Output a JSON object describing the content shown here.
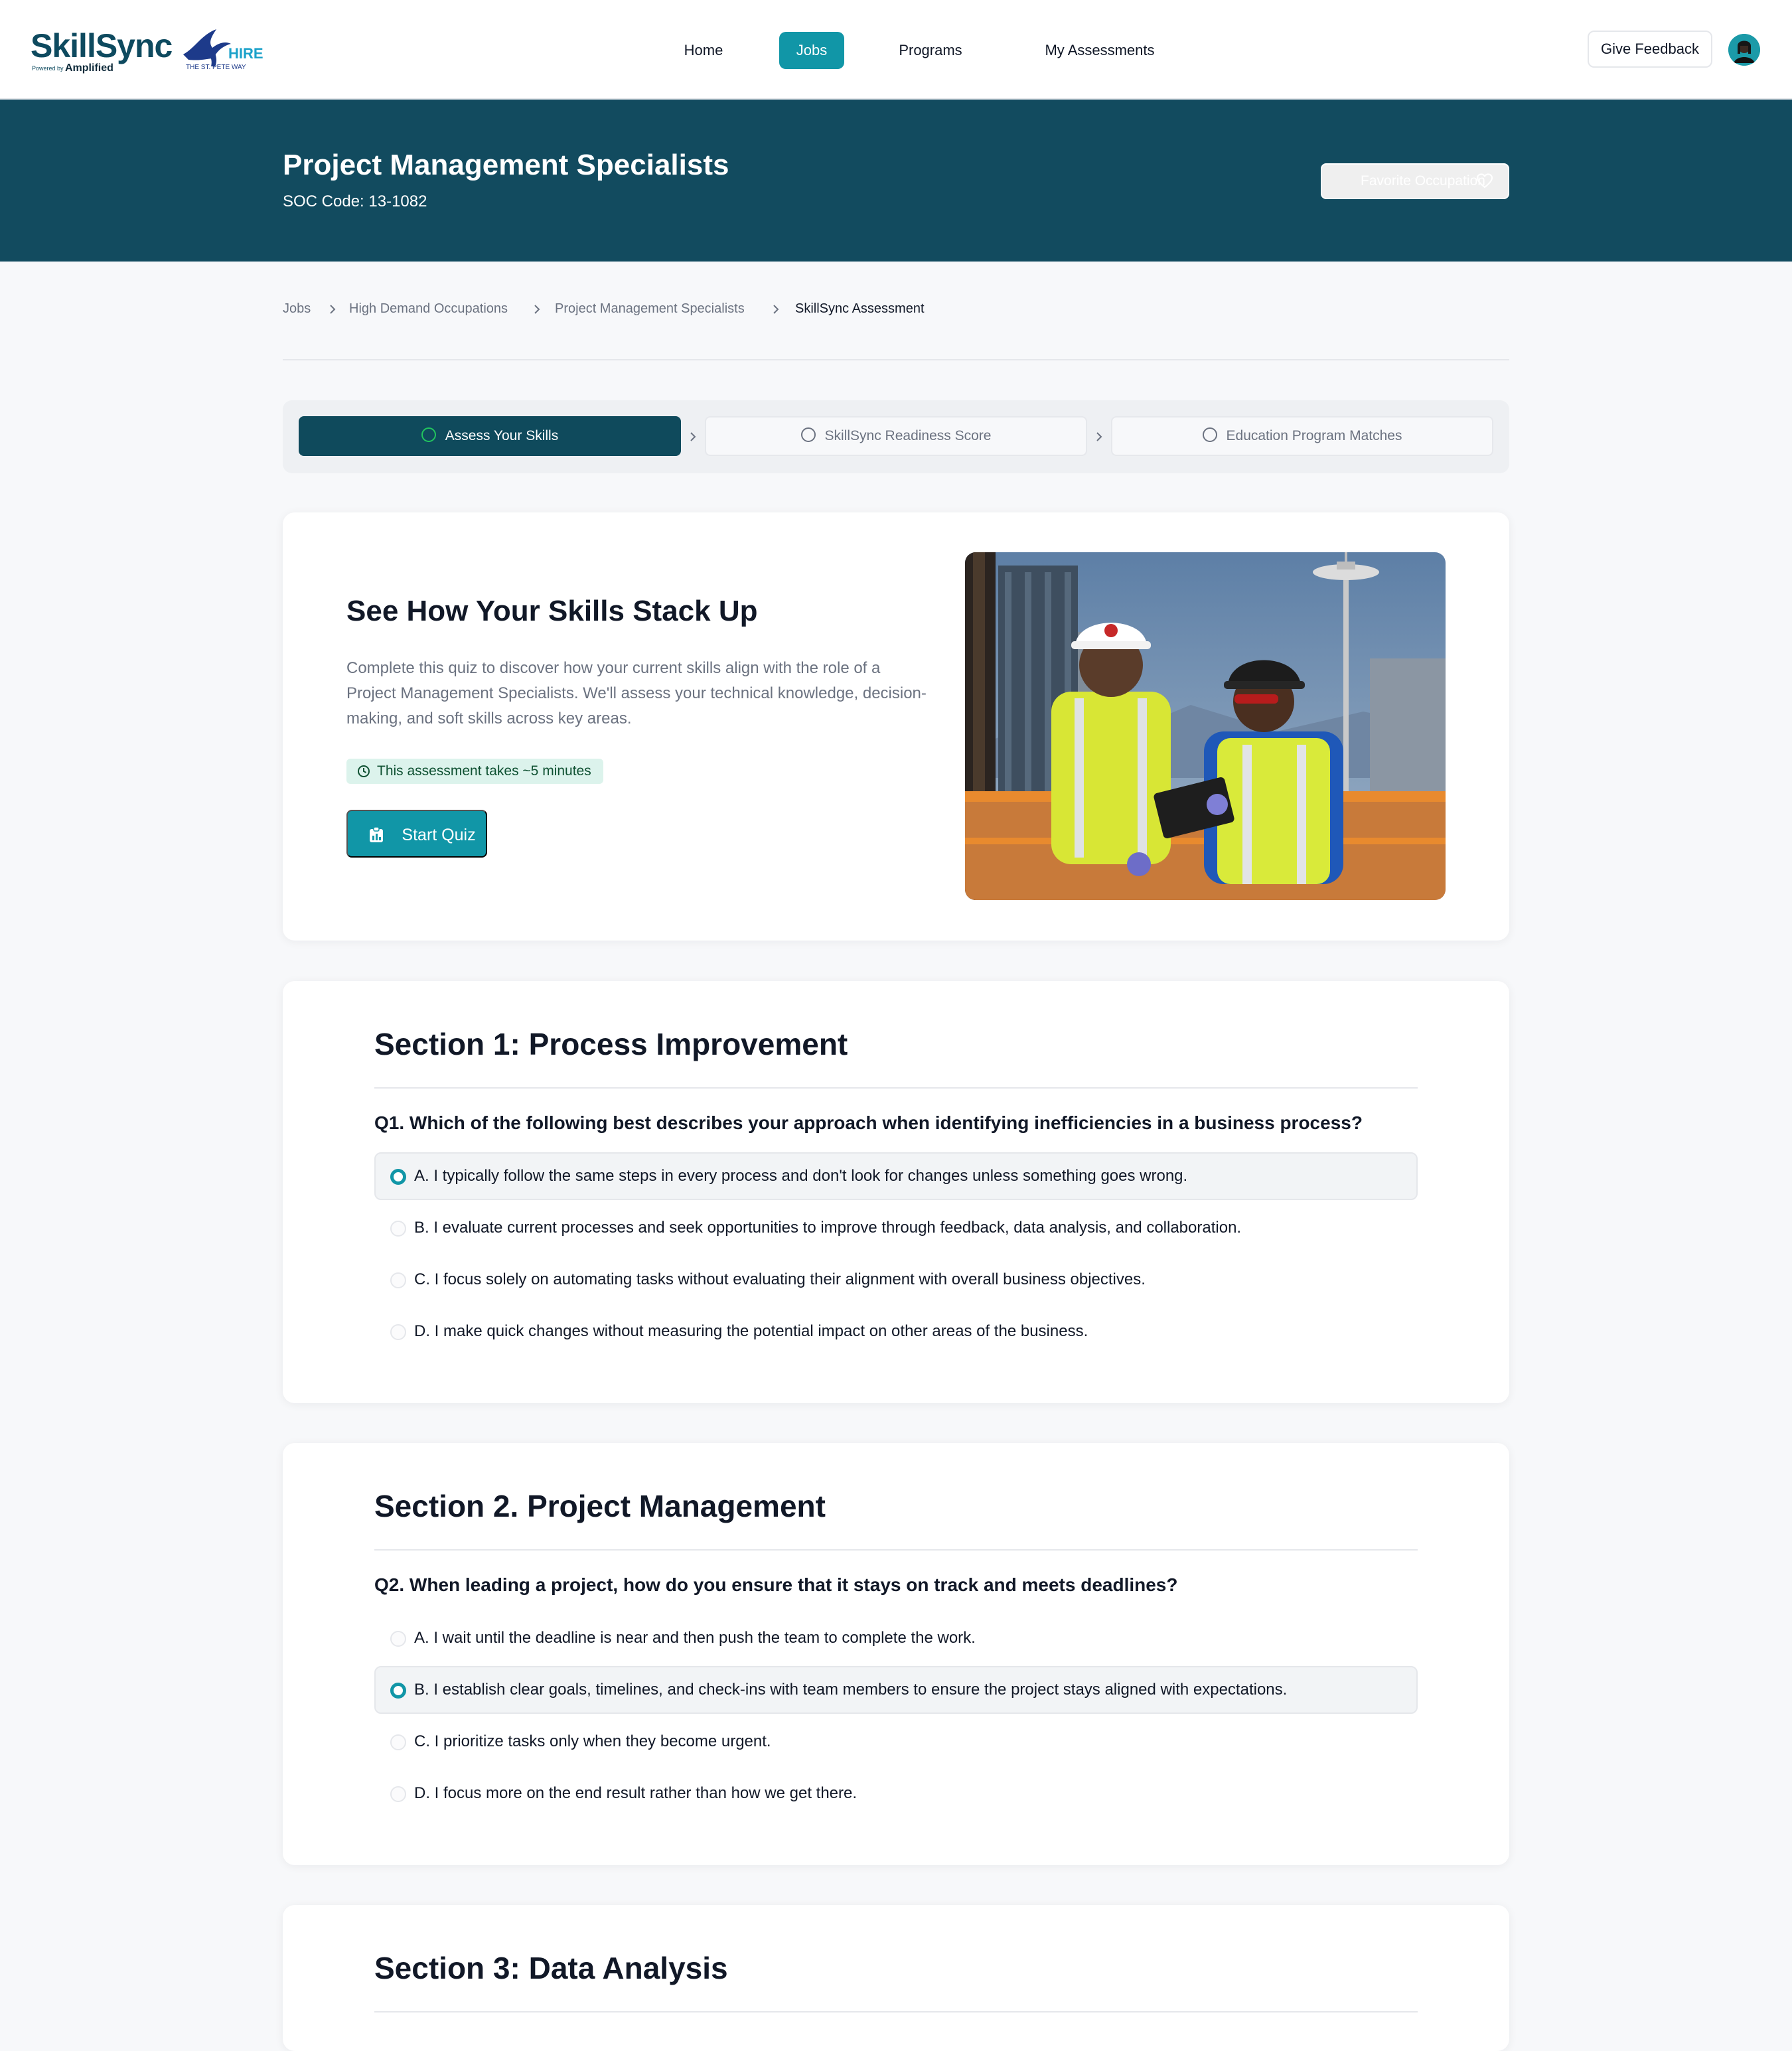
{
  "brand": {
    "name": "SkillSync",
    "powered_by": "Powered by",
    "partner": "Amplified",
    "hire_logo_text": "HIRE",
    "hire_logo_sub": "THE ST. PETE WAY"
  },
  "nav": {
    "items": [
      {
        "label": "Home"
      },
      {
        "label": "Jobs"
      },
      {
        "label": "Programs"
      },
      {
        "label": "My Assessments"
      }
    ],
    "active": "Jobs",
    "feedback_label": "Give Feedback"
  },
  "hero": {
    "title": "Project Management Specialists",
    "soc": "SOC Code: 13-1082",
    "favorite_label": "Favorite Occupation"
  },
  "breadcrumb": [
    "Jobs",
    "High Demand Occupations",
    "Project Management Specialists",
    "SkillSync Assessment"
  ],
  "stepper": [
    {
      "label": "Assess Your Skills",
      "state": "active"
    },
    {
      "label": "SkillSync Readiness Score",
      "state": "pending"
    },
    {
      "label": "Education Program Matches",
      "state": "pending"
    }
  ],
  "intro": {
    "title": "See How Your Skills Stack Up",
    "description": "Complete this quiz to discover how your current skills align with the role of a Project Management Specialists. We'll assess your technical knowledge, decision-making, and soft skills across key areas.",
    "time_badge": "This assessment takes ~5 minutes",
    "start_label": "Start Quiz"
  },
  "sections": [
    {
      "title": "Section 1: Process Improvement",
      "question": "Q1. Which of the following best describes your approach when identifying inefficiencies in a business process?",
      "options": [
        "A. I typically follow the same steps in every process and don't look for changes unless something goes wrong.",
        "B. I evaluate current processes and seek opportunities to improve through feedback, data analysis, and collaboration.",
        "C. I focus solely on automating tasks without evaluating their alignment with overall business objectives.",
        "D. I make quick changes without measuring the potential impact on other areas of the business."
      ],
      "selected_index": 0
    },
    {
      "title": "Section 2. Project Management",
      "question": "Q2. When leading a project, how do you ensure that it stays on track and meets deadlines?",
      "options": [
        "A. I wait until the deadline is near and then push the team to complete the work.",
        "B. I establish clear goals, timelines, and check-ins with team members to ensure the project stays aligned with expectations.",
        "C. I prioritize tasks only when they become urgent.",
        "D. I focus more on the end result rather than how we get there."
      ],
      "selected_index": 1
    },
    {
      "title": "Section 3: Data Analysis"
    }
  ],
  "colors": {
    "brand_teal": "#1196a7",
    "hero_bg": "#124b5f",
    "stepper_active": "#0f4a5c",
    "badge_bg": "#dcf3ec"
  }
}
